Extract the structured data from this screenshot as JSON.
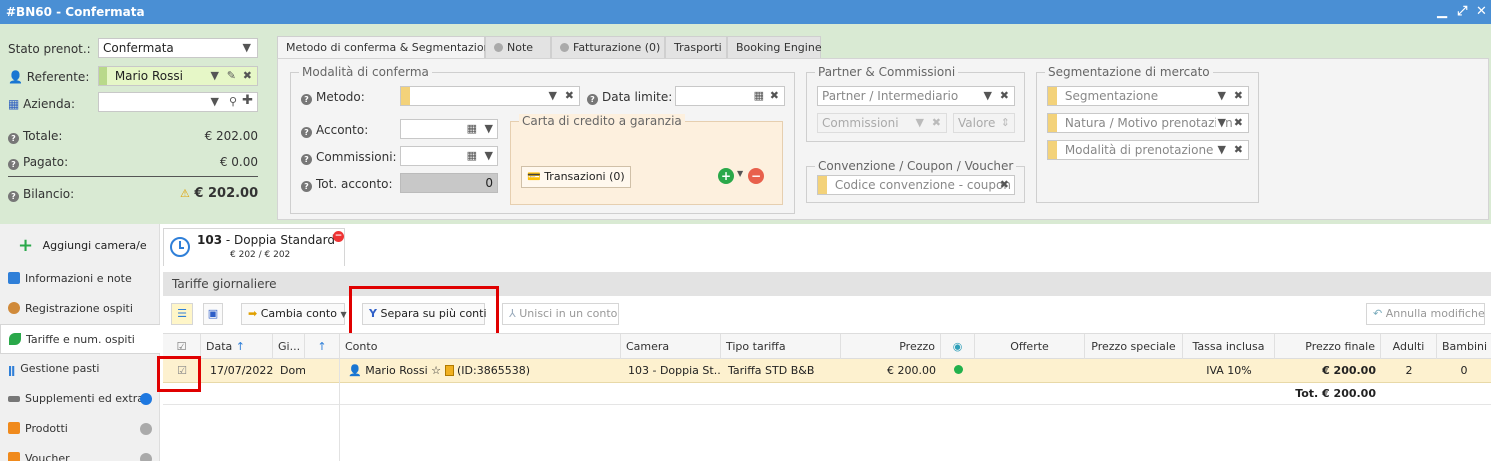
{
  "window": {
    "title": "#BN60 - Confermata"
  },
  "summary": {
    "stato_label": "Stato prenot.:",
    "stato_value": "Confermata",
    "referente_label": "Referente:",
    "referente_value": "Mario Rossi",
    "azienda_label": "Azienda:",
    "totale_label": "Totale:",
    "totale_value": "€ 202.00",
    "pagato_label": "Pagato:",
    "pagato_value": "€ 0.00",
    "bilancio_label": "Bilancio:",
    "bilancio_value": "€ 202.00"
  },
  "tabs": {
    "t1": "Metodo di conferma & Segmentazione",
    "t2": "Note",
    "t3": "Fatturazione (0)",
    "t4": "Trasporti",
    "t5": "Booking Engine"
  },
  "conferma": {
    "legend": "Modalità di conferma",
    "metodo_label": "Metodo:",
    "data_limite_label": "Data limite:",
    "acconto_label": "Acconto:",
    "commissioni_label": "Commissioni:",
    "tot_acconto_label": "Tot. acconto:",
    "tot_acconto_value": "0",
    "carta_legend": "Carta di credito a garanzia",
    "transazioni_label": "Transazioni (0)"
  },
  "partner": {
    "legend": "Partner & Commissioni",
    "partner_placeholder": "Partner / Intermediario",
    "commissioni_placeholder": "Commissioni",
    "valore_placeholder": "Valore"
  },
  "convenzione": {
    "legend": "Convenzione / Coupon / Voucher",
    "codice_placeholder": "Codice convenzione - coupon"
  },
  "segmentazione": {
    "legend": "Segmentazione di mercato",
    "seg_placeholder": "Segmentazione",
    "natura_placeholder": "Natura / Motivo prenotazion",
    "modalita_placeholder": "Modalità di prenotazione"
  },
  "sidebar": {
    "add_room": "Aggiungi camera/e",
    "items": [
      {
        "label": "Informazioni e note"
      },
      {
        "label": "Registrazione ospiti"
      },
      {
        "label": "Tariffe e num. ospiti"
      },
      {
        "label": "Gestione pasti"
      },
      {
        "label": "Supplementi ed extra"
      },
      {
        "label": "Prodotti"
      },
      {
        "label": "Voucher"
      }
    ]
  },
  "room": {
    "number": "103",
    "name": " - Doppia Standard",
    "amount": "€ 202 / € 202"
  },
  "section": {
    "title": "Tariffe giornaliere"
  },
  "toolbar": {
    "cambia_conto": "Cambia conto",
    "separa": "Separa su più conti",
    "unisci": "Unisci in un conto",
    "annulla": "Annulla modifiche"
  },
  "grid": {
    "headers": {
      "data": "Data",
      "giorno": "Gi...",
      "conto": "Conto",
      "camera": "Camera",
      "tipo_tariffa": "Tipo tariffa",
      "prezzo": "Prezzo",
      "offerte": "Offerte",
      "prezzo_speciale": "Prezzo speciale",
      "tassa_inclusa": "Tassa inclusa",
      "prezzo_finale": "Prezzo finale",
      "adulti": "Adulti",
      "bambini": "Bambini"
    },
    "rows": [
      {
        "data": "17/07/2022",
        "giorno": "Dom",
        "conto_name": "Mario Rossi ☆",
        "conto_id": "(ID:3865538)",
        "camera": "103 - Doppia St...",
        "tipo_tariffa": "Tariffa STD B&B",
        "prezzo": "€ 200.00",
        "tassa_inclusa": "IVA 10%",
        "prezzo_finale": "€ 200.00",
        "adulti": "2",
        "bambini": "0"
      }
    ],
    "total": "Tot. € 200.00"
  },
  "colors": {
    "titlebar": "#4a8fd4",
    "panel": "#d9ead3",
    "row_highlight": "#fdf1cf",
    "highlight_box": "#e00000",
    "active_dot": "#1e90ff",
    "green_dot": "#22b14c"
  }
}
